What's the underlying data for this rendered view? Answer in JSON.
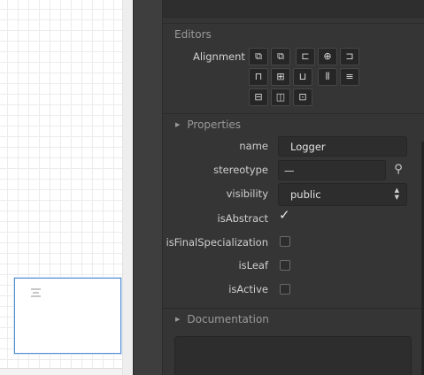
{
  "editors": {
    "title": "Editors",
    "alignment_label": "Alignment"
  },
  "align_buttons": [
    {
      "icon": "send-to-back-icon",
      "glyph": "⧉"
    },
    {
      "icon": "bring-to-front-icon",
      "glyph": "⧉"
    },
    {
      "icon": "align-left-icon",
      "glyph": "⊏"
    },
    {
      "icon": "align-center-icon",
      "glyph": "⊕"
    },
    {
      "icon": "align-right-icon",
      "glyph": "⊐"
    },
    {
      "icon": "align-top-icon",
      "glyph": "⊓"
    },
    {
      "icon": "align-middle-icon",
      "glyph": "⊞"
    },
    {
      "icon": "align-bottom-icon",
      "glyph": "⊔"
    },
    {
      "icon": "space-equally-horizontal-icon",
      "glyph": "⦀"
    },
    {
      "icon": "space-equally-vertical-icon",
      "glyph": "≡"
    },
    {
      "icon": "set-width-equally-icon",
      "glyph": "⊟"
    },
    {
      "icon": "set-height-equally-icon",
      "glyph": "◫"
    },
    {
      "icon": "set-size-equally-icon",
      "glyph": "⊡"
    }
  ],
  "properties": {
    "title": "Properties",
    "name_label": "name",
    "name_value": "Logger",
    "stereotype_label": "stereotype",
    "stereotype_value": "—",
    "visibility_label": "visibility",
    "visibility_value": "public",
    "isAbstract_label": "isAbstract",
    "isAbstract": true,
    "isFinalSpecialization_label": "isFinalSpecialization",
    "isFinalSpecialization": false,
    "isLeaf_label": "isLeaf",
    "isLeaf": false,
    "isActive_label": "isActive",
    "isActive": false
  },
  "documentation": {
    "title": "Documentation",
    "value": ""
  },
  "colors": {
    "panel_bg": "#353535",
    "field_bg": "#2d2d2d",
    "minimap_border": "#4f8cd6"
  }
}
